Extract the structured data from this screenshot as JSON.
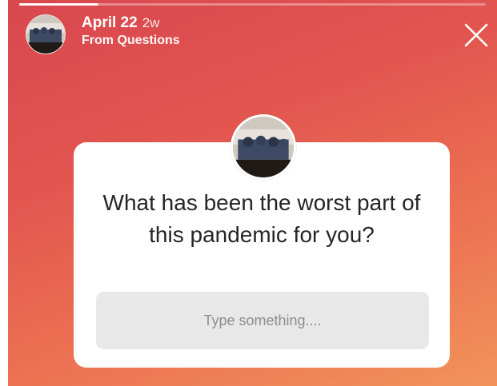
{
  "story": {
    "progress": 0.17,
    "date": "April 22",
    "age": "2w",
    "source": "From Questions"
  },
  "question_card": {
    "question": "What has been the worst part of this pandemic for you?",
    "placeholder": "Type something...."
  },
  "icons": {
    "close": "close-icon",
    "avatar": "avatar-photo"
  },
  "colors": {
    "gradient_top": "#d9474f",
    "gradient_bottom": "#f2935a",
    "card": "#ffffff",
    "input_bg": "#e8e8e8"
  }
}
